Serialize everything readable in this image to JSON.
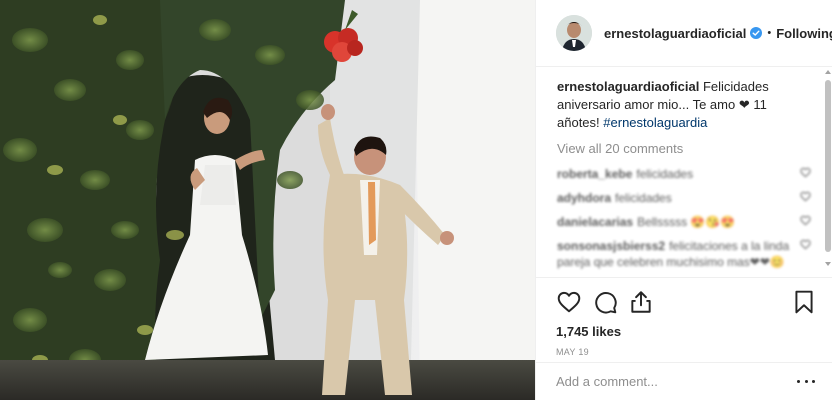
{
  "header": {
    "username": "ernestolaguardiaoficial",
    "separator": "•",
    "follow_label": "Following"
  },
  "caption": {
    "username": "ernestolaguardiaoficial",
    "text": "Felicidades aniversario amor mio... Te amo ❤ 11 añotes!",
    "hashtag": "#ernestolaguardia"
  },
  "view_all_label": "View all 20 comments",
  "comments": [
    {
      "user": "roberta_kebe",
      "text": "felicidades"
    },
    {
      "user": "adyhdora",
      "text": "felicidades"
    },
    {
      "user": "danielacarias",
      "text": "Bellsssss 😍😘😍"
    },
    {
      "user": "sonsonasjsbierss2",
      "text": "felicitaciones a la linda pareja que celebren muchisimo mas❤❤😊"
    }
  ],
  "actions": {
    "likes": "1,745 likes",
    "date": "MAY 19"
  },
  "add_comment": {
    "placeholder": "Add a comment..."
  },
  "icons": {
    "like": "heart-icon",
    "comment": "comment-bubble-icon",
    "share": "share-icon",
    "save": "bookmark-icon",
    "verified": "verified-badge-icon",
    "more": "more-options-icon"
  },
  "colors": {
    "verified_blue": "#3897f0",
    "hashtag_blue": "#00376b",
    "muted_text": "#8e8e8e"
  }
}
